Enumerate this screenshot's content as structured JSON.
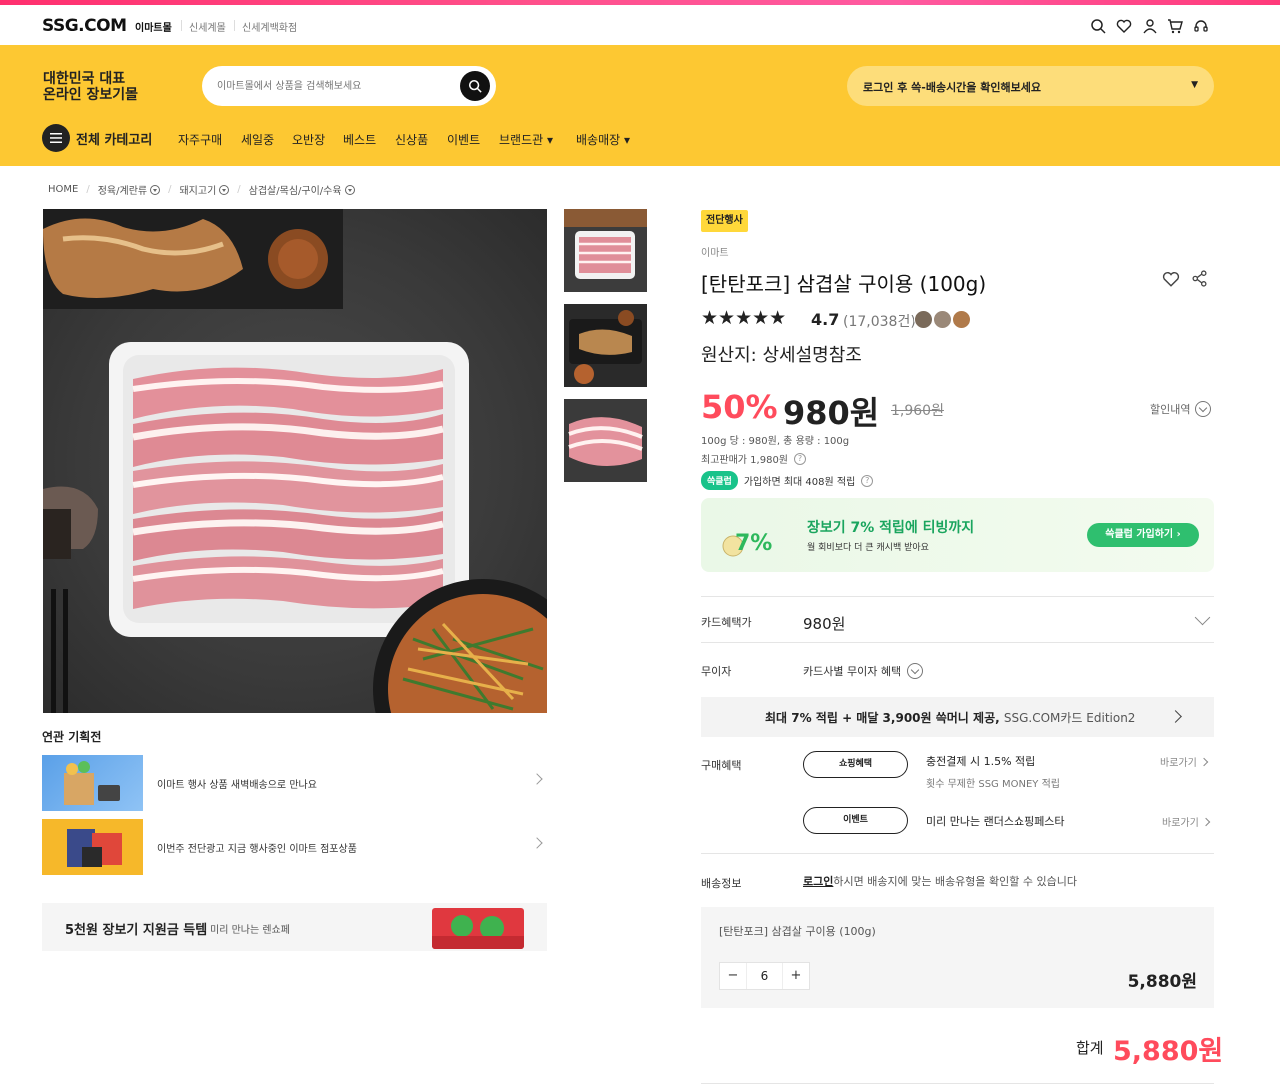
{
  "header": {
    "logo": "SSG.COM",
    "mall_tabs": [
      "이마트몰",
      "신세계몰",
      "신세계백화점"
    ],
    "slogan_line1": "대한민국 대표",
    "slogan_line2": "온라인 장보기몰",
    "search_placeholder": "이마트몰에서 상품을 검색해보세요",
    "delivery_notice": "로그인 후 쓱-배송시간을 확인해보세요",
    "category_label": "전체 카테고리",
    "menu": [
      "자주구매",
      "세일중",
      "오반장",
      "베스트",
      "신상품",
      "이벤트",
      "브랜드관 ▾",
      "배송매장 ▾"
    ]
  },
  "breadcrumb": [
    "HOME",
    "정육/계란류",
    "돼지고기",
    "삼겹살/목심/구이/수육"
  ],
  "related": {
    "title": "연관 기획전",
    "items": [
      {
        "text": "이마트 행사 상품 새벽배송으로 만나요"
      },
      {
        "text": "이번주 전단광고 지금 행사중인 이마트 점포상품"
      }
    ],
    "banner_title": "5천원 장보기 지원금 득템",
    "banner_sub": "미리 만나는 렌쇼페"
  },
  "product": {
    "badge": "전단행사",
    "seller": "이마트",
    "title": "[탄탄포크] 삼겹살 구이용 (100g)",
    "stars": "★★★★★",
    "rating": "4.7",
    "review_count": "(17,038건)",
    "origin": "원산지: 상세설명참조",
    "discount": "50%",
    "price": "980원",
    "original_price": "1,960원",
    "discount_history": "할인내역",
    "unit_price": "100g 당 : 980원, 총 용량 : 100g",
    "max_price": "최고판매가 1,980원",
    "club_badge": "쓱클럽",
    "club_text": "가입하면 최대 408원 적립",
    "club_banner_title": "장보기 7% 적립에 티빙까지",
    "club_banner_sub": "월 회비보다 더 큰 캐시백 받아요",
    "club_join": "쓱클럽 가입하기 ›",
    "club_icon": "7%"
  },
  "benefits": {
    "card_label": "카드혜택가",
    "card_price": "980원",
    "noint_label": "무이자",
    "noint_text": "카드사별 무이자 혜택",
    "card_banner_bold": "최대 7% 적립 + 매달 3,900원 쓱머니 제공,",
    "card_banner_light": "SSG.COM카드 Edition2",
    "purchase_label": "구매혜택",
    "pill1": "쇼핑혜택",
    "benefit1": "충전결제 시 1.5% 적립",
    "benefit1_sub": "횟수 무제한 SSG MONEY 적립",
    "pill2": "이벤트",
    "benefit2": "미리 만나는 랜더스쇼핑페스타",
    "goto": "바로가기",
    "shipping_label": "배송정보",
    "shipping_login": "로그인",
    "shipping_text": "하시면 배송지에 맞는 배송유형을 확인할 수 있습니다"
  },
  "order": {
    "name": "[탄탄포크] 삼겹살 구이용 (100g)",
    "qty": "6",
    "minus": "−",
    "plus": "+",
    "price": "5,880원",
    "total_label": "합계",
    "total_price": "5,880원"
  },
  "colors": {
    "brand_yellow": "#fdc832",
    "accent_red": "#ff4b5c",
    "club_green": "#2fbf6f"
  }
}
